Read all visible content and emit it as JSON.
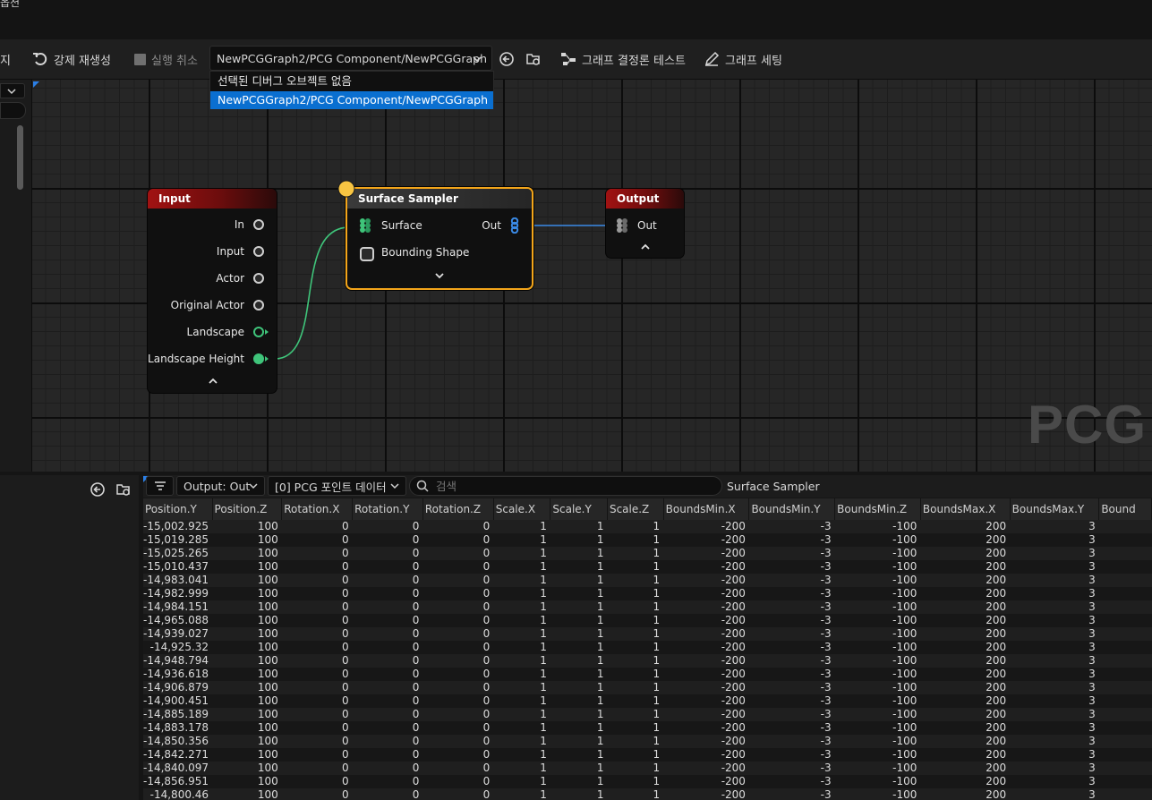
{
  "window": {
    "title_fragment": "옵션"
  },
  "toolbar": {
    "partial_label": "지",
    "force_regen_label": "강제 재생성",
    "undo_run_label": "실행 취소",
    "debug_object_value": "NewPCGGraph2/PCG Component/NewPCGGraph",
    "graph_test_label": "그래프 결정론 테스트",
    "graph_settings_label": "그래프 세팅"
  },
  "debug_dropdown": {
    "options": [
      "선택된 디버그 오브젝트 없음",
      "NewPCGGraph2/PCG Component/NewPCGGraph"
    ],
    "selected_index": 1
  },
  "graph": {
    "watermark": "PCG",
    "nodes": {
      "input": {
        "title": "Input",
        "pins": [
          "In",
          "Input",
          "Actor",
          "Original Actor",
          "Landscape",
          "Landscape Height"
        ]
      },
      "surface_sampler": {
        "title": "Surface Sampler",
        "input_pins": [
          "Surface",
          "Bounding Shape"
        ],
        "output_pins": [
          "Out"
        ]
      },
      "output": {
        "title": "Output",
        "pins": [
          "Out"
        ]
      }
    }
  },
  "data_view": {
    "output_filter": "Output: Out",
    "data_selector": "[0] PCG 포인트 데이터",
    "search_placeholder": "검색",
    "node_name": "Surface Sampler",
    "columns": [
      "Position.Y",
      "Position.Z",
      "Rotation.X",
      "Rotation.Y",
      "Rotation.Z",
      "Scale.X",
      "Scale.Y",
      "Scale.Z",
      "BoundsMin.X",
      "BoundsMin.Y",
      "BoundsMin.Z",
      "BoundsMax.X",
      "BoundsMax.Y",
      "Bound"
    ],
    "position_y_values": [
      "-15,002.925",
      "-15,019.285",
      "-15,025.265",
      "-15,010.437",
      "-14,983.041",
      "-14,982.999",
      "-14,984.151",
      "-14,965.088",
      "-14,939.027",
      "-14,925.32",
      "-14,948.794",
      "-14,936.618",
      "-14,906.879",
      "-14,900.451",
      "-14,885.189",
      "-14,883.178",
      "-14,850.356",
      "-14,842.271",
      "-14,840.097",
      "-14,856.951",
      "-14,800.46"
    ],
    "row_constants": [
      "100",
      "0",
      "0",
      "0",
      "1",
      "1",
      "1",
      "-200",
      "-3",
      "-100",
      "200",
      "3",
      ""
    ]
  },
  "colors": {
    "accent_selection": "#0a6fd0",
    "node_selected_border": "#f3a51a",
    "wire_green": "#3fc47a",
    "wire_blue": "#3a8ae6",
    "header_red": "#a11212"
  }
}
